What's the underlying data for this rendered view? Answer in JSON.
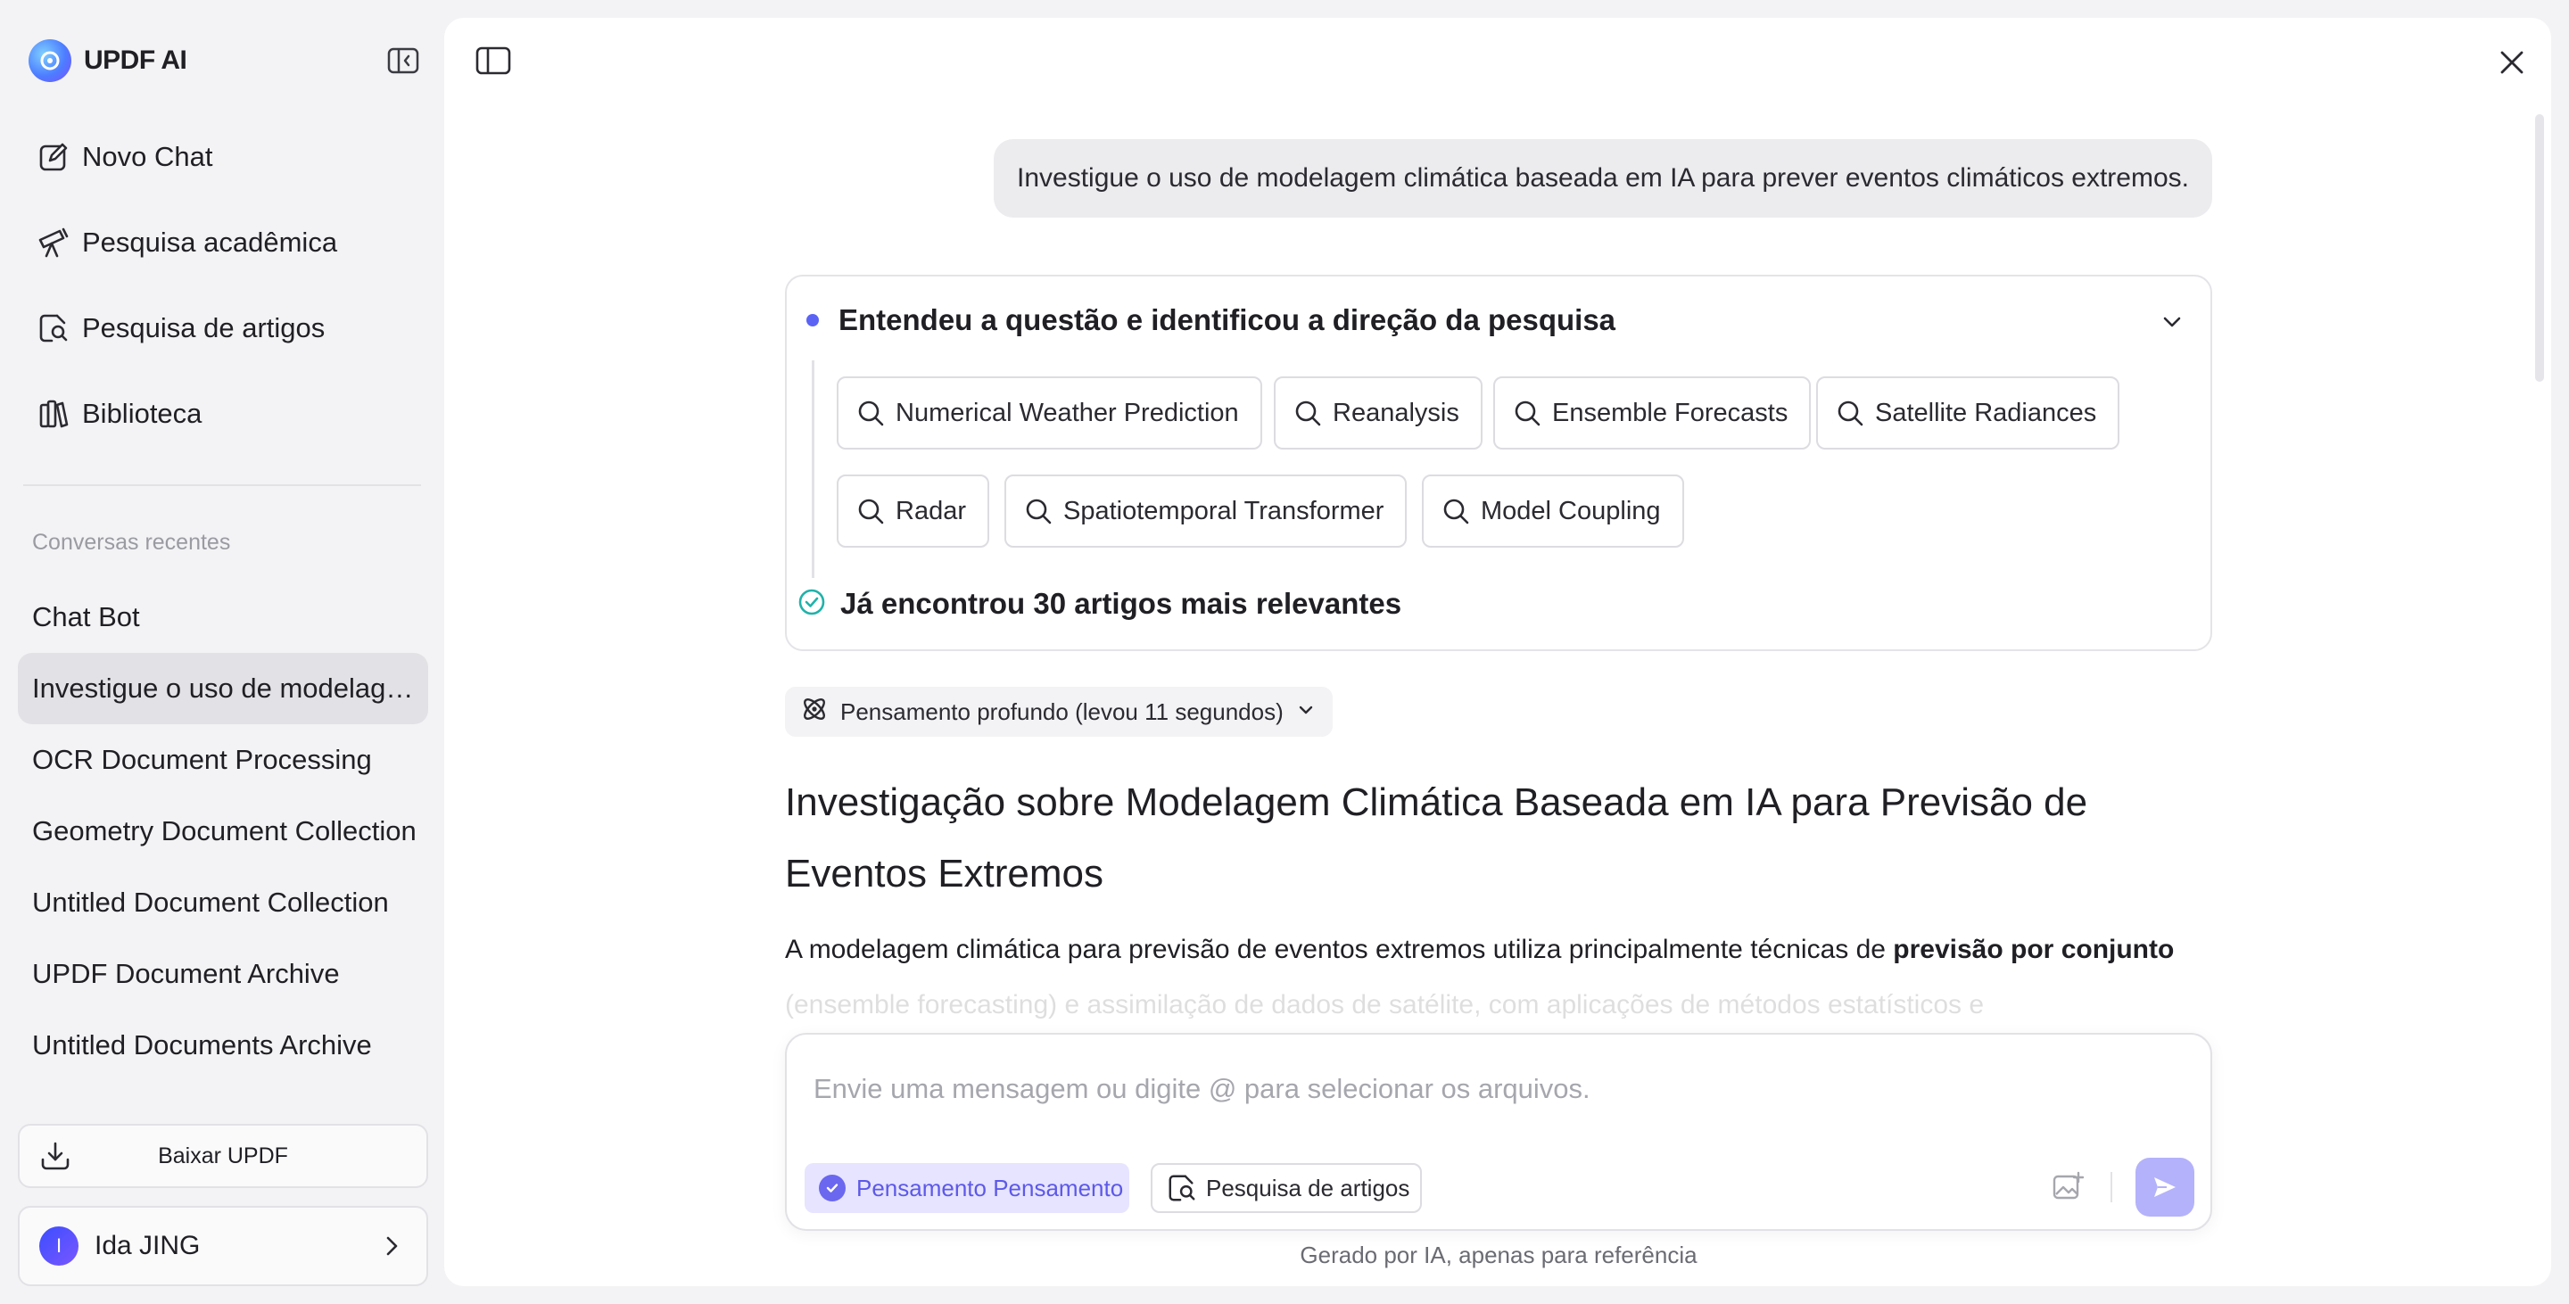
{
  "app": {
    "name": "UPDF AI"
  },
  "sidebar": {
    "nav": [
      {
        "label": "Novo Chat",
        "icon": "new-chat-icon"
      },
      {
        "label": "Pesquisa acadêmica",
        "icon": "telescope-icon"
      },
      {
        "label": "Pesquisa de artigos",
        "icon": "document-search-icon"
      },
      {
        "label": "Biblioteca",
        "icon": "library-icon"
      }
    ],
    "recent_title": "Conversas recentes",
    "recent": [
      {
        "label": "Chat Bot"
      },
      {
        "label": "Investigue o uso de modelagem climática baseada em IA para prever eventos climáticos extremos.",
        "active": true
      },
      {
        "label": "OCR Document Processing"
      },
      {
        "label": "Geometry Document Collection"
      },
      {
        "label": "Untitled Document Collection"
      },
      {
        "label": "UPDF Document Archive"
      },
      {
        "label": "Untitled Documents Archive"
      }
    ],
    "download_label": "Baixar UPDF",
    "user": {
      "initial": "I",
      "name": "Ida JING"
    }
  },
  "conversation": {
    "user_message": "Investigue o uso de modelagem climática baseada em IA para prever eventos climáticos extremos.",
    "research": {
      "title": "Entendeu a questão e identificou a direção da pesquisa",
      "keywords": [
        "Numerical Weather Prediction",
        "Reanalysis",
        "Ensemble Forecasts",
        "Satellite Radiances",
        "Radar",
        "Spatiotemporal Transformer",
        "Model Coupling"
      ],
      "found": "Já encontrou 30 artigos mais relevantes"
    },
    "thinking_label": "Pensamento profundo (levou 11 segundos)",
    "answer_title": "Investigação sobre Modelagem Climática Baseada em IA para Previsão de Eventos Extremos",
    "answer_intro": "A modelagem climática para previsão de eventos extremos utiliza principalmente técnicas de ",
    "answer_bold": "previsão por conjunto",
    "answer_faded": "(ensemble forecasting) e assimilação de dados de satélite, com aplicações de métodos estatísticos e"
  },
  "composer": {
    "placeholder": "Envie uma mensagem ou digite @ para selecionar os arquivos.",
    "deep_think_label": "Pensamento Pensamento",
    "article_search_label": "Pesquisa de artigos"
  },
  "disclaimer": "Gerado por IA, apenas para referência",
  "colors": {
    "accent": "#5b63f5",
    "send_button": "#b4b2fa",
    "deep_think_bg": "#e6e4ff",
    "success": "#20b2aa"
  }
}
